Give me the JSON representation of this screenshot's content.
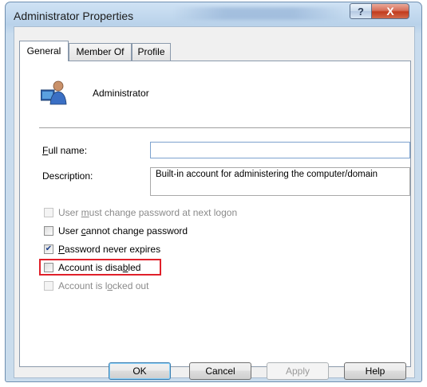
{
  "window": {
    "title": "Administrator Properties",
    "help_glyph": "?",
    "close_glyph": "X"
  },
  "tabs": [
    {
      "label": "General",
      "active": true
    },
    {
      "label": "Member Of",
      "active": false
    },
    {
      "label": "Profile",
      "active": false
    }
  ],
  "user": {
    "name": "Administrator",
    "icon": "user-icon"
  },
  "fields": {
    "full_name": {
      "label_accel": "F",
      "label_rest": "ull name:",
      "value": ""
    },
    "description": {
      "label": "Description:",
      "value": "Built-in account for administering the computer/domain"
    }
  },
  "checkboxes": [
    {
      "pre": "User ",
      "accel": "m",
      "post": "ust change password at next logon",
      "checked": false,
      "enabled": false
    },
    {
      "pre": "User ",
      "accel": "c",
      "post": "annot change password",
      "checked": false,
      "enabled": true
    },
    {
      "pre": "",
      "accel": "P",
      "post": "assword never expires",
      "checked": true,
      "enabled": true
    },
    {
      "pre": "Account is disa",
      "accel": "b",
      "post": "led",
      "checked": false,
      "enabled": true
    },
    {
      "pre": "Account is l",
      "accel": "o",
      "post": "cked out",
      "checked": false,
      "enabled": false
    }
  ],
  "buttons": {
    "ok": "OK",
    "cancel": "Cancel",
    "apply": "Apply",
    "help": "Help"
  },
  "colors": {
    "highlight_box": "#e0202a",
    "checkmark": "#1b3f8b"
  }
}
